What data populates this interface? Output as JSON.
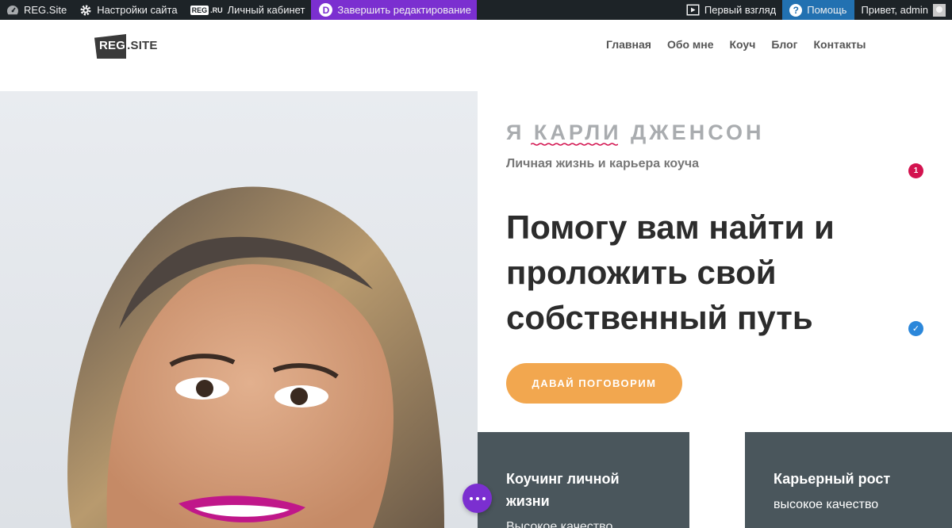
{
  "adminbar": {
    "site_name": "REG.Site",
    "customize_label": "Настройки сайта",
    "reg_badge": "REG",
    "reg_suffix": ".RU",
    "cabinet_label": "Личный кабинет",
    "finish_editing_label": "Завершить редактирование",
    "first_look_label": "Первый взгляд",
    "help_label": "Помощь",
    "greeting": "Привет, admin",
    "divi_letter": "D",
    "help_mark": "?"
  },
  "header": {
    "logo_reg": "REG",
    "logo_site": "SITE",
    "nav": [
      "Главная",
      "Обо мне",
      "Коуч",
      "Блог",
      "Контакты"
    ]
  },
  "hero": {
    "intro": "Я КАРЛИ ДЖЕНСОН",
    "subtitle": "Личная жизнь и карьера коуча",
    "headline": "Помогу вам найти и проложить свой собственный путь",
    "cta_label": "ДАВАЙ ПОГОВОРИМ",
    "badge_count": "1",
    "check_mark": "✓"
  },
  "cards": [
    {
      "title": "Коучинг личной жизни",
      "subtitle": "Высокое качество"
    },
    {
      "title": "Карьерный рост",
      "subtitle": "высокое качество"
    }
  ],
  "colors": {
    "adminbar_bg": "#1d2327",
    "divi_purple": "#7b2fd0",
    "help_blue": "#2271b1",
    "cta_orange": "#f2a74f",
    "card_bg": "#4a565c",
    "spellcheck_red": "#d3134f"
  },
  "icons": {
    "site": "dashboard-icon",
    "customize": "gear-icon",
    "first_look": "video-play-icon",
    "help": "help-icon",
    "avatar": "avatar",
    "fab": "more-dots-icon"
  }
}
